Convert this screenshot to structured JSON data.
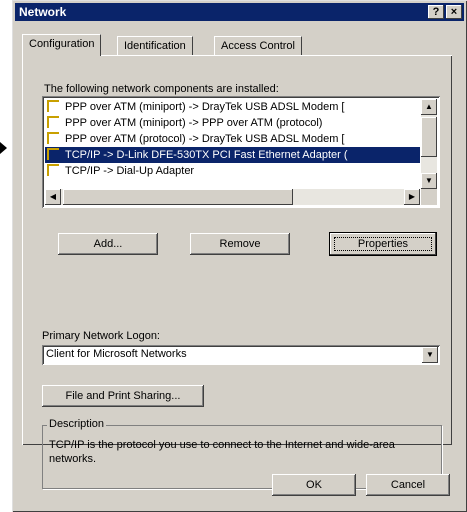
{
  "window": {
    "title": "Network",
    "help_glyph": "?",
    "close_glyph": "×"
  },
  "tabs": [
    {
      "label": "Configuration"
    },
    {
      "label": "Identification"
    },
    {
      "label": "Access Control"
    }
  ],
  "components": {
    "heading": "The following network components are installed:",
    "items": [
      "PPP over ATM (miniport) -> DrayTek USB ADSL Modem [",
      "PPP over ATM (miniport) -> PPP over ATM (protocol)",
      "PPP over ATM (protocol) -> DrayTek USB ADSL Modem [",
      "TCP/IP -> D-Link DFE-530TX PCI Fast Ethernet Adapter (",
      "TCP/IP -> Dial-Up Adapter"
    ],
    "selected_index": 3
  },
  "buttons": {
    "add": "Add...",
    "remove": "Remove",
    "properties": "Properties"
  },
  "logon": {
    "label": "Primary Network Logon:",
    "value": "Client for Microsoft Networks"
  },
  "sharing_button": "File and Print Sharing...",
  "description": {
    "label": "Description",
    "text": "TCP/IP is the protocol you use to connect to the Internet and wide-area networks."
  },
  "footer": {
    "ok": "OK",
    "cancel": "Cancel"
  },
  "colors": {
    "titlebar": "#0a246a",
    "selection": "#0a246a",
    "face": "#d4d0c8"
  }
}
